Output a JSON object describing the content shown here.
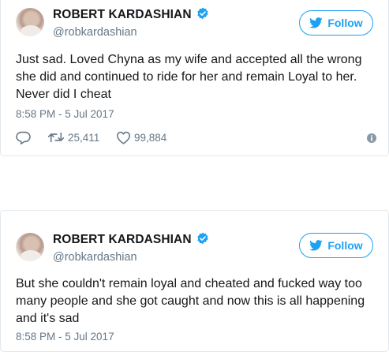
{
  "tweets": [
    {
      "author_name": "ROBERT KARDASHIAN",
      "handle": "@robkardashian",
      "follow_label": "Follow",
      "text": "Just sad. Loved Chyna as my wife and accepted all the wrong she did and continued to ride for her and remain Loyal to her. Never did I cheat",
      "timestamp": "8:58 PM - 5 Jul 2017",
      "retweets": "25,411",
      "likes": "99,884"
    },
    {
      "author_name": "ROBERT KARDASHIAN",
      "handle": "@robkardashian",
      "follow_label": "Follow",
      "text": "But she couldn't remain loyal and cheated and fucked way too many people and she got caught and now this is all happening and it's sad",
      "timestamp": "8:58 PM - 5 Jul 2017"
    }
  ],
  "colors": {
    "accent": "#1da1f2",
    "text": "#14171a",
    "muted": "#657786",
    "border": "#e1e8ed"
  },
  "icons": [
    "verified-icon",
    "twitter-bird-icon",
    "reply-icon",
    "retweet-icon",
    "like-icon",
    "info-icon"
  ]
}
